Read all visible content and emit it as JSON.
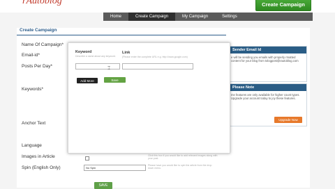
{
  "header": {
    "logo_text": "rAutoblog",
    "create_button": "Create Campaign",
    "nav": [
      "Home",
      "Create Campaign",
      "My Campaign",
      "Settings"
    ]
  },
  "form": {
    "section_title": "Create Campaign",
    "labels": {
      "name": "Name Of Campaign*",
      "email": "Email-id*",
      "posts": "Posts Per Day*",
      "keywords": "Keywords*",
      "anchor": "Anchor Text",
      "language": "Language",
      "images": "Images in Article",
      "spin": "Spin (English Only)"
    },
    "images_hint": "Click this box if you would like to add relevant images along with your post.",
    "spin_value": "No Spin",
    "spin_hint": "Please have you would like to spin the article from the drop down menu.",
    "save_bottom": "SAVE"
  },
  "modal": {
    "keyword_label": "Keyword",
    "keyword_hint": "Describe a name about any keyword.",
    "link_label": "Link",
    "link_hint": "(Please enter the complete URL e.g. http://www.google.com)",
    "add_more": "Add More",
    "save": "Save"
  },
  "sender_widget": {
    "title": "Sender Email Id",
    "text": "e will be sending you emails with properly rmatted content for your blog from tologpost@rautoblog.com"
  },
  "note_widget": {
    "title": "Please Note",
    "text": "me features are only available for higher count types. Upgrade your account today to joy these features.",
    "button": "Upgrade Now"
  }
}
